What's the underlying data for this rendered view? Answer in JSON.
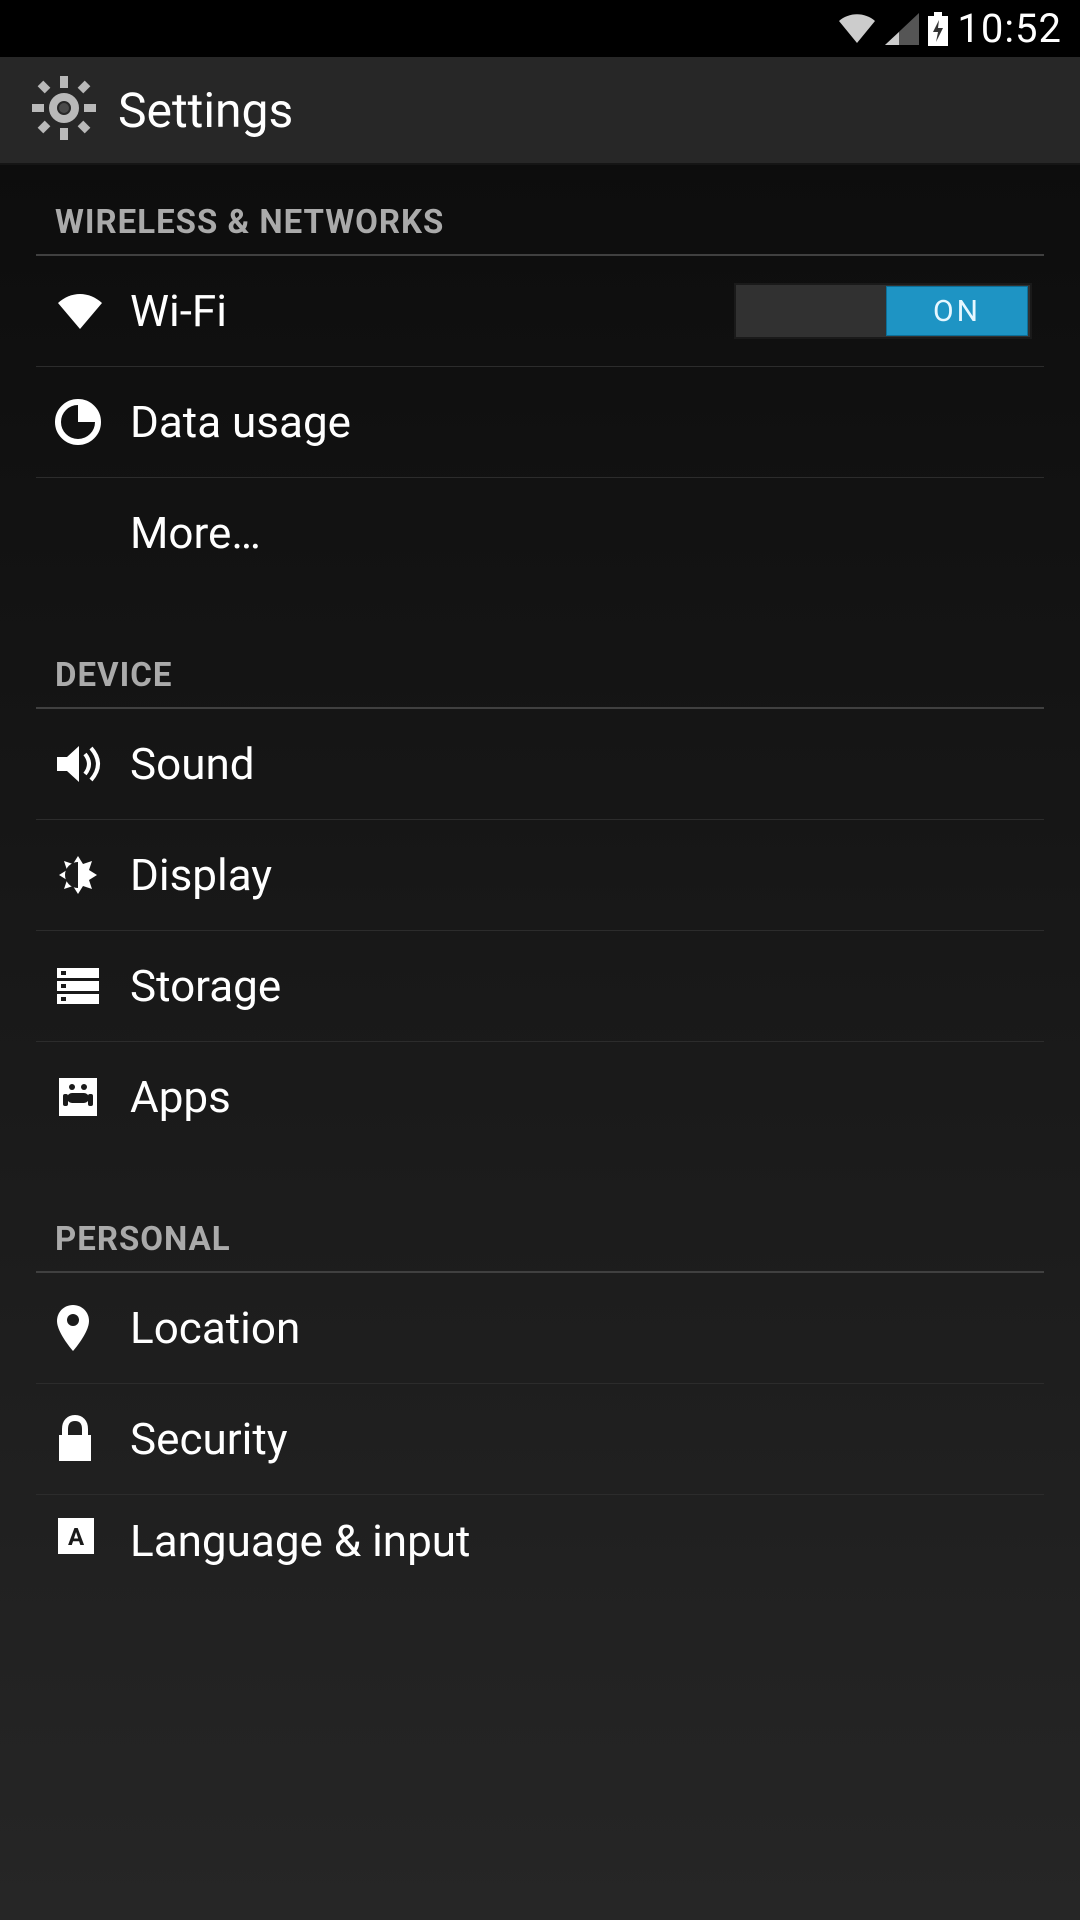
{
  "status": {
    "time": "10:52"
  },
  "header": {
    "title": "Settings"
  },
  "toggle": {
    "on_label": "ON"
  },
  "sections": [
    {
      "title": "WIRELESS & NETWORKS",
      "items": [
        {
          "label": "Wi-Fi",
          "icon": "wifi",
          "toggle": true
        },
        {
          "label": "Data usage",
          "icon": "data"
        },
        {
          "label": "More…",
          "icon": ""
        }
      ]
    },
    {
      "title": "DEVICE",
      "items": [
        {
          "label": "Sound",
          "icon": "sound"
        },
        {
          "label": "Display",
          "icon": "display"
        },
        {
          "label": "Storage",
          "icon": "storage"
        },
        {
          "label": "Apps",
          "icon": "apps"
        }
      ]
    },
    {
      "title": "PERSONAL",
      "items": [
        {
          "label": "Location",
          "icon": "location"
        },
        {
          "label": "Security",
          "icon": "security"
        },
        {
          "label": "Language & input",
          "icon": "language"
        }
      ]
    }
  ]
}
